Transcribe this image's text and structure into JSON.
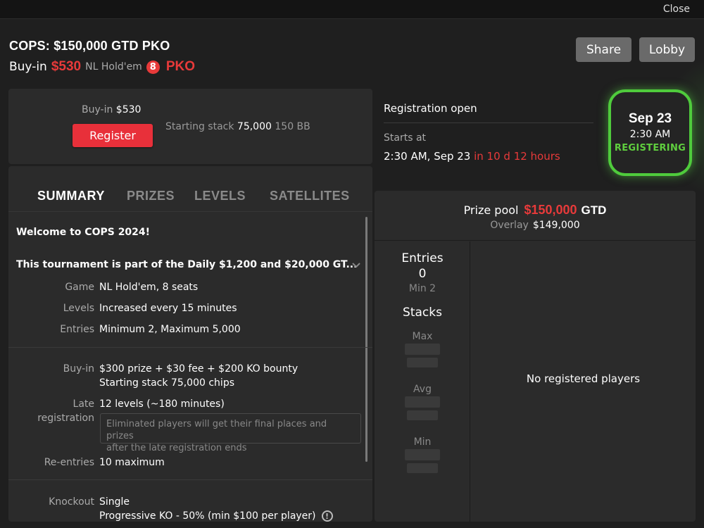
{
  "window": {
    "close_label": "Close"
  },
  "header": {
    "title": "COPS: $150,000 GTD PKO",
    "buyin_label": "Buy-in",
    "buyin_price": "$530",
    "game": "NL Hold'em",
    "seats_badge": "8",
    "pko_label": "PKO",
    "share_label": "Share",
    "lobby_label": "Lobby"
  },
  "registration": {
    "buyin_label": "Buy-in",
    "buyin_value": "$530",
    "register_label": "Register",
    "stack_label": "Starting stack",
    "stack_value": "75,000",
    "stack_bb": "150 BB"
  },
  "status": {
    "reg_open": "Registration open",
    "starts_label": "Starts at",
    "starts_value": "2:30 AM, Sep 23",
    "starts_in": "in 10 d 12 hours",
    "date_day": "Sep 23",
    "date_time": "2:30 AM",
    "date_status": "REGISTERING",
    "accent": "#4fcb3c"
  },
  "tabs": [
    {
      "label": "SUMMARY",
      "active": true
    },
    {
      "label": "PRIZES",
      "active": false
    },
    {
      "label": "LEVELS",
      "active": false
    },
    {
      "label": "SATELLITES",
      "active": false
    }
  ],
  "summary": {
    "welcome": "Welcome to COPS 2024!",
    "part_of": "This tournament is part of the Daily $1,200 and $20,000 GT...",
    "rows": {
      "game": {
        "label": "Game",
        "value": "NL Hold'em, 8 seats"
      },
      "levels": {
        "label": "Levels",
        "value": "Increased every 15 minutes"
      },
      "entries": {
        "label": "Entries",
        "value": "Minimum 2, Maximum 5,000"
      },
      "buyin": {
        "label": "Buy-in",
        "value": "$300 prize + $30 fee + $200 KO bounty",
        "value2": "Starting stack 75,000 chips"
      },
      "late_reg": {
        "label": "Late",
        "label2": "registration",
        "value": "12 levels (~180 minutes)",
        "note1": "Eliminated players will get their final places and prizes",
        "note2": "after the late registration ends"
      },
      "reentries": {
        "label": "Re-entries",
        "value": "10 maximum"
      },
      "knockout": {
        "label": "Knockout",
        "value": "Single",
        "value2": "Progressive KO - 50% (min $100 per player)"
      }
    }
  },
  "prize_pool": {
    "label": "Prize pool",
    "amount": "$150,000",
    "gtd": "GTD",
    "overlay_label": "Overlay",
    "overlay_value": "$149,000"
  },
  "stats": {
    "entries_label": "Entries",
    "entries_value": "0",
    "entries_min": "Min 2",
    "stacks_label": "Stacks",
    "max_label": "Max",
    "avg_label": "Avg",
    "min_label": "Min"
  },
  "players": {
    "empty_text": "No registered players"
  },
  "colors": {
    "red": "#e83a3a",
    "green": "#4fcb3c",
    "panel": "#2b2b2b",
    "background": "#1f1f1f"
  }
}
